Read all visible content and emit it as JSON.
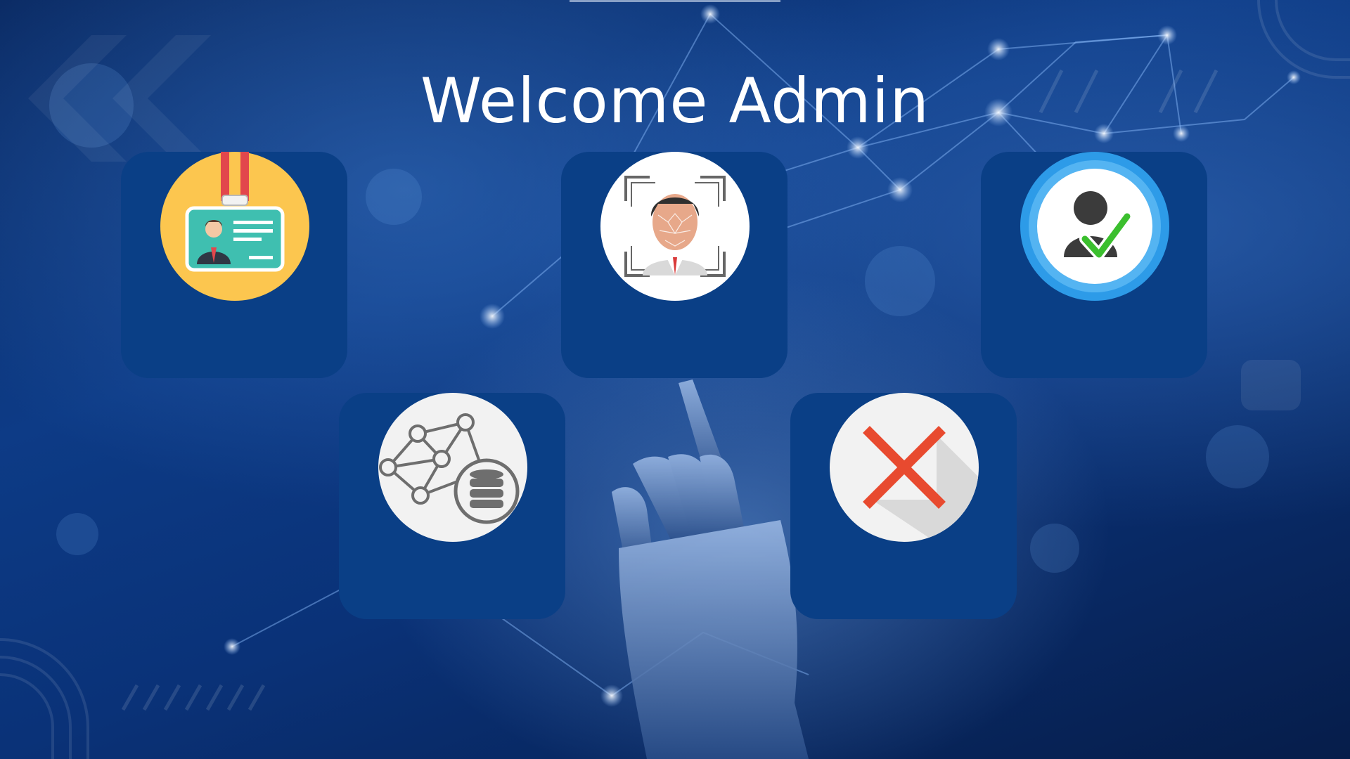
{
  "header": {
    "title": "Welcome Admin"
  },
  "tiles": [
    {
      "icon": "id-badge-icon",
      "label": ""
    },
    {
      "icon": "face-recognition-icon",
      "label": ""
    },
    {
      "icon": "user-verified-icon",
      "label": ""
    },
    {
      "icon": "network-database-icon",
      "label": ""
    },
    {
      "icon": "close-x-icon",
      "label": ""
    }
  ],
  "colors": {
    "tile_background": "#0a3f86",
    "badge_yellow": "#fcc64f",
    "badge_teal": "#3fbfb0",
    "lanyard_red": "#e2474c",
    "verify_blue": "#2d9be8",
    "check_green": "#3bbf2e",
    "close_red": "#e84a2f"
  }
}
